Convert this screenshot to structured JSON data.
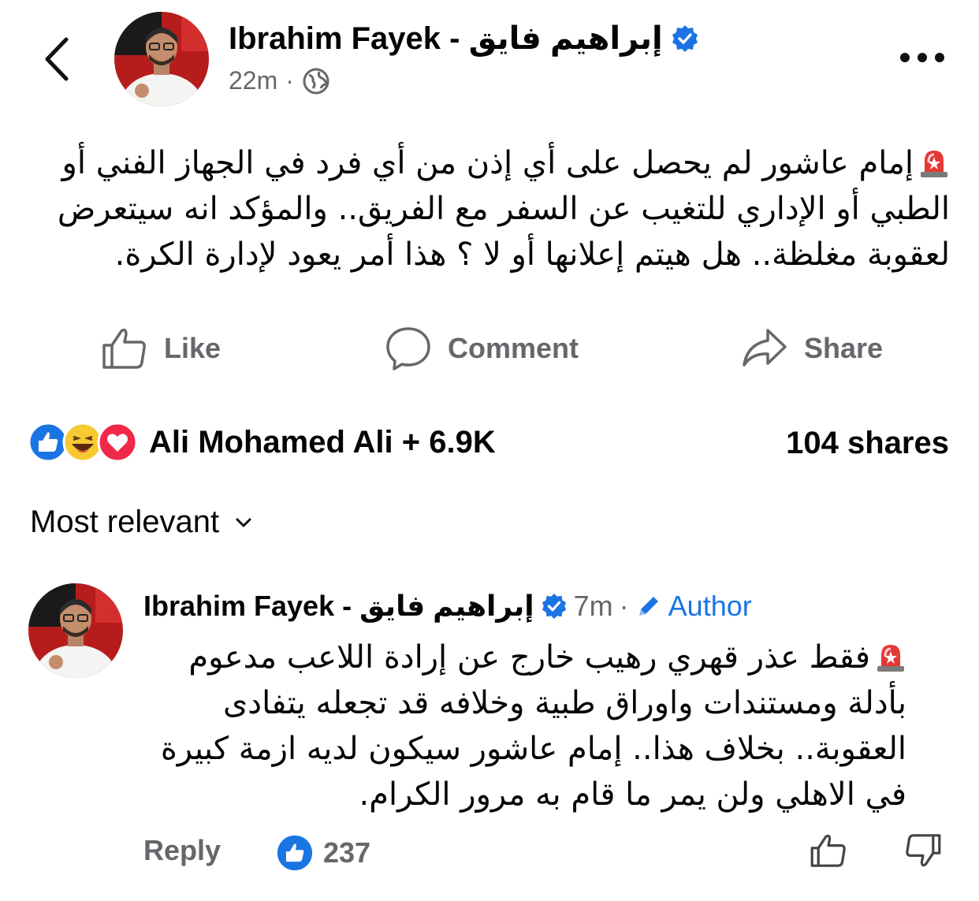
{
  "post": {
    "author": "Ibrahim Fayek - إبراهيم  فايق",
    "time": "22m",
    "text": "إمام عاشور لم يحصل على أي إذن من أي فرد في الجهاز الفني أو الطبي أو الإداري للتغيب عن السفر مع الفريق.. والمؤكد انه سيتعرض لعقوبة مغلظة.. هل هيتم إعلانها أو لا ؟ هذا أمر يعود لإدارة الكرة."
  },
  "actions": {
    "like": "Like",
    "comment": "Comment",
    "share": "Share"
  },
  "reactions": {
    "summary": "Ali Mohamed Ali + 6.9K",
    "shares": "104 shares"
  },
  "sort": {
    "label": "Most relevant"
  },
  "comment": {
    "author": "Ibrahim Fayek - إبراهيم  فايق",
    "time": "7m",
    "badge": "Author",
    "text": "فقط عذر قهري رهيب خارج عن إرادة اللاعب مدعوم بأدلة ومستندات واوراق طبية وخلافه قد تجعله يتفادى العقوبة.. بخلاف هذا.. إمام عاشور سيكون لديه ازمة كبيرة في الاهلي ولن يمر ما قام به مرور الكرام.",
    "reply": "Reply",
    "likes": "237"
  },
  "icons": {
    "back": "chevron-left-icon",
    "verified": "verified-badge-icon",
    "audience": "globe-icon",
    "more": "more-horizontal-icon",
    "siren": "siren-emoji-icon",
    "like": "thumbs-up-icon",
    "comment": "speech-bubble-icon",
    "share": "share-arrow-icon"
  },
  "colors": {
    "brand_blue": "#1b74e4",
    "secondary_text": "#65676b",
    "love_red": "#f0284a",
    "haha_yellow": "#f7c932"
  }
}
